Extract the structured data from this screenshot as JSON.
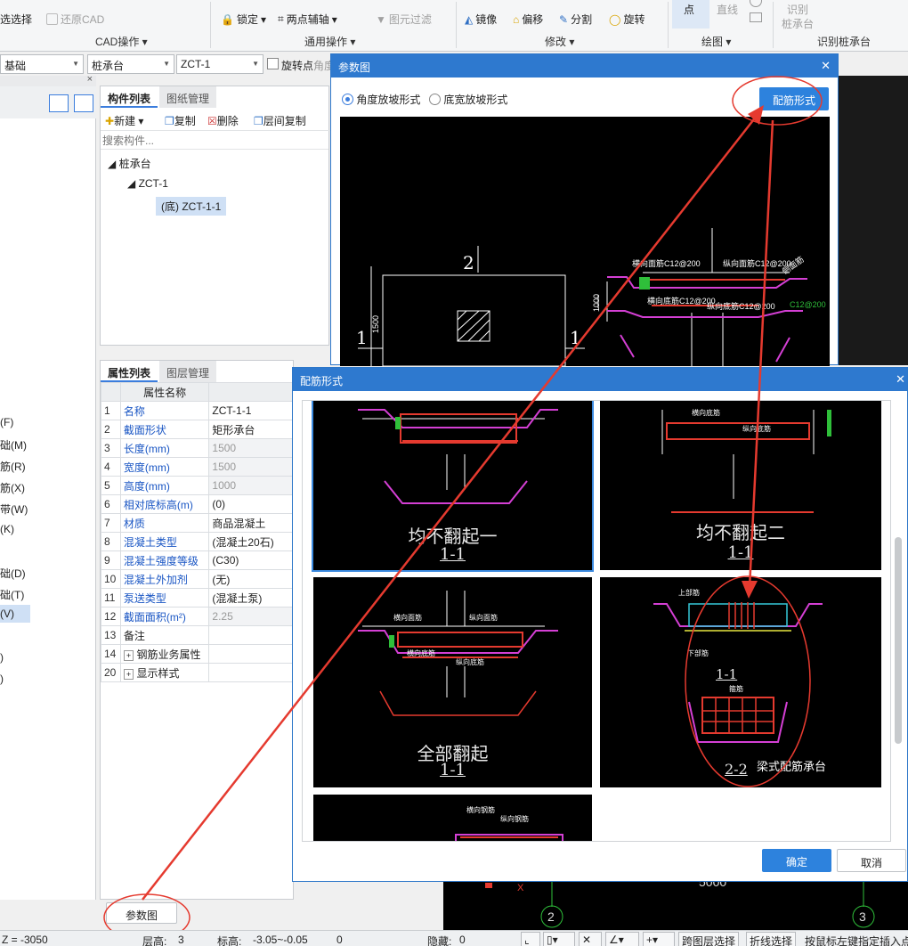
{
  "ribbon": {
    "items": {
      "select": "选选择",
      "restore_cad": "还原CAD",
      "cad_ops": "CAD操作",
      "lock": "锁定",
      "two_point_axis": "两点辅轴",
      "filter": "图元过滤",
      "general_ops": "通用操作",
      "mirror": "镜像",
      "offset": "偏移",
      "split": "分割",
      "rotate": "旋转",
      "modify": "修改",
      "point": "点",
      "line": "直线",
      "draw": "绘图",
      "identify": "识别",
      "pile_cap": "桩承台",
      "identify_pile_cap": "识别桩承台"
    }
  },
  "dropdowns": {
    "layer": "基础",
    "type": "桩承台",
    "component": "ZCT-1",
    "rotate_point": "旋转点",
    "angle": "角度"
  },
  "left_strip": {
    "items": [
      "(F)",
      "础(M)",
      "筋(R)",
      "筋(X)",
      "带(W)",
      "(K)",
      "础(D)",
      "础(T)",
      "(V)",
      ")",
      ")"
    ]
  },
  "component_panel": {
    "tabs": [
      "构件列表",
      "图纸管理"
    ],
    "toolbar": {
      "new": "新建",
      "copy": "复制",
      "delete": "删除",
      "floor_copy": "层间复制"
    },
    "search_placeholder": "搜索构件...",
    "tree": {
      "root": "桩承台",
      "child": "ZCT-1",
      "leaf": "(底) ZCT-1-1"
    }
  },
  "property_panel": {
    "tabs": [
      "属性列表",
      "图层管理"
    ],
    "header": "属性名称",
    "rows": [
      {
        "n": "1",
        "k": "名称",
        "v": "ZCT-1-1"
      },
      {
        "n": "2",
        "k": "截面形状",
        "v": "矩形承台"
      },
      {
        "n": "3",
        "k": "长度(mm)",
        "v": "1500"
      },
      {
        "n": "4",
        "k": "宽度(mm)",
        "v": "1500"
      },
      {
        "n": "5",
        "k": "高度(mm)",
        "v": "1000"
      },
      {
        "n": "6",
        "k": "相对底标高(m)",
        "v": "(0)"
      },
      {
        "n": "7",
        "k": "材质",
        "v": "商品混凝土"
      },
      {
        "n": "8",
        "k": "混凝土类型",
        "v": "(混凝土20石)"
      },
      {
        "n": "9",
        "k": "混凝土强度等级",
        "v": "(C30)"
      },
      {
        "n": "10",
        "k": "混凝土外加剂",
        "v": "(无)"
      },
      {
        "n": "11",
        "k": "泵送类型",
        "v": "(混凝土泵)"
      },
      {
        "n": "12",
        "k": "截面面积(m²)",
        "v": "2.25"
      },
      {
        "n": "13",
        "k": "备注",
        "v": ""
      },
      {
        "n": "14",
        "k": "钢筋业务属性",
        "v": ""
      },
      {
        "n": "20",
        "k": "显示样式",
        "v": ""
      }
    ],
    "param_button": "参数图"
  },
  "param_dialog": {
    "title": "参数图",
    "radio1": "角度放坡形式",
    "radio2": "底宽放坡形式",
    "config_button": "配筋形式",
    "drawing": {
      "dim1": "1500",
      "dim2": "1000",
      "mark2": "2",
      "mark1a": "1",
      "mark1b": "1",
      "lbl_top": "横向面筋C12@200",
      "lbl_top2": "纵向面筋C12@200",
      "lbl_bot": "横向底筋C12@200",
      "lbl_bot2": "纵向底筋C12@200",
      "lbl_c200": "C12@200",
      "lbl_side": "侧面筋"
    }
  },
  "config_dialog": {
    "title": "配筋形式",
    "options": [
      {
        "cap": "均不翻起一",
        "sec": "1-1"
      },
      {
        "cap": "均不翻起二",
        "sec": "1-1"
      },
      {
        "cap": "全部翻起",
        "sec": "1-1"
      },
      {
        "cap": "梁式配筋承台",
        "sec": "2-2",
        "sec1": "1-1"
      }
    ],
    "ok": "确定",
    "cancel": "取消",
    "labels": {
      "h_top": "横向面筋",
      "v_top": "纵向面筋",
      "h_bot": "横向底筋",
      "v_bot": "纵向底筋",
      "top_rebar": "上部筋",
      "bot_rebar": "下部筋",
      "stirrup": "箍筋",
      "h_rebar": "横向钢筋",
      "v_rebar": "纵向钢筋",
      "side": "侧面筋"
    }
  },
  "canvas_bg": {
    "dim": "5000",
    "axis2": "2",
    "axis3": "3"
  },
  "status": {
    "z": "Z = -3050",
    "floor": "层高:",
    "floor_v": "3",
    "elev": "标高:",
    "elev_v": "-3.05~-0.05",
    "zero": "0",
    "hidden": "隐藏:",
    "hidden_v": "0",
    "cross_floor": "跨图层选择",
    "polyline": "折线选择",
    "hint": "按鼠标左键指定插入点"
  },
  "colors": {
    "accent": "#2e79cf",
    "annotation": "#e53a2f"
  }
}
